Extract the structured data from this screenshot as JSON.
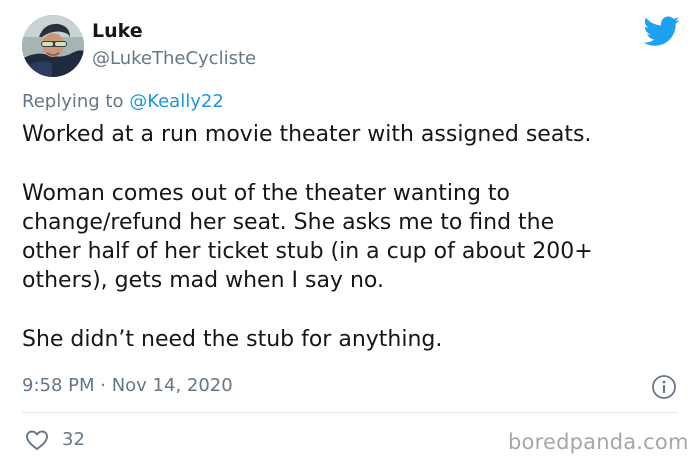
{
  "tweet": {
    "author": {
      "display_name": "Luke",
      "handle": "@LukeTheCycliste",
      "avatar_icon": "cyclist-avatar"
    },
    "reply_prefix": "Replying to ",
    "reply_to": "@Keally22",
    "body": {
      "line_1": "Worked at a run movie theater with assigned seats.",
      "line_2": "Woman comes out of the theater wanting to",
      "line_3": "change/refund her seat. She asks me to find the",
      "line_4": "other half of her ticket stub (in a cup of about 200+",
      "line_5": "others), gets mad when I say no.",
      "line_6": "She didn’t need the stub for anything."
    },
    "timestamp": "9:58 PM · Nov 14, 2020",
    "like_count": "32"
  },
  "icons": {
    "brand": "twitter-bird-icon",
    "info": "info-icon",
    "like": "heart-icon"
  },
  "colors": {
    "twitter_blue": "#1da1f2",
    "mention_blue": "#1b95e0",
    "secondary_text": "#657786",
    "divider": "#e1e8ed"
  },
  "watermark": "boredpanda.com"
}
